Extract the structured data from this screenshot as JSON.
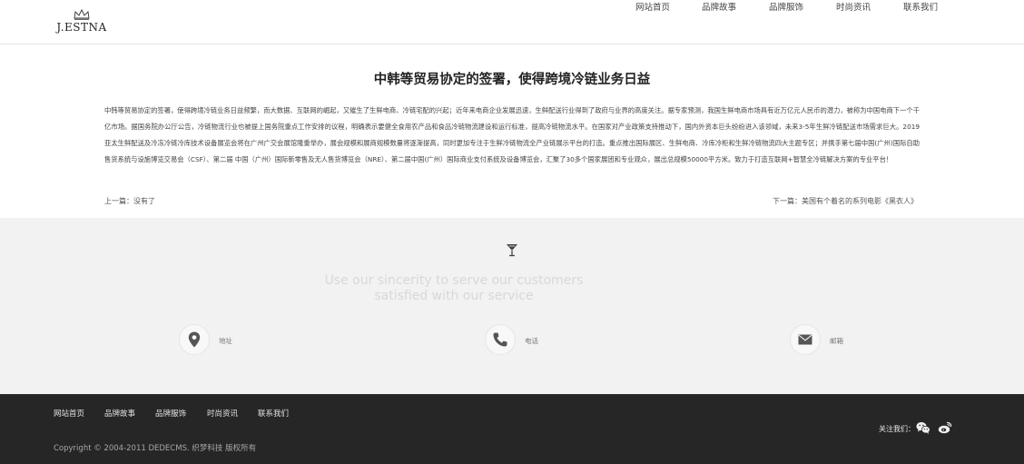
{
  "header": {
    "logo_text": "J.ESTNA",
    "nav": [
      "网站首页",
      "品牌故事",
      "品牌服饰",
      "时尚资讯",
      "联系我们"
    ]
  },
  "article": {
    "title": "中韩等贸易协定的签署，使得跨境冷链业务日益",
    "body": "中韩等贸易协定的签署，使得跨境冷链业务日益频繁，而大数据、互联网的崛起，又催生了生鲜电商、冷链宅配的兴起；近年来电商企业发展迅速，生鲜配送行业得到了政府与业界的高度关注。据专家预测，我国生鲜电商市场具有近万亿元人民币的潜力，被称为中国电商下一个千亿市场。据国务院办公厅公告，冷链物流行业也被提上国务院重点工作安排的议程，明确表示要健全食用农产品和食品冷链物流建设和运行标准，提高冷链物流水平。在国家对产业政策支持推动下，国内外资本巨头纷纷进入该领域，未来3-5年生鲜冷链配送市场需求巨大。2019亚太生鲜配送及冷冻冷链冷库技术设备展览会将在广州广交会展馆隆重举办，展会规模和展商规模数量将逐渐提高，同时更加专注于生鲜冷链物流全产业链展示平台的打造。重点推出国际展区、生鲜电商、冷库冷柜和生鲜冷链物流四大主题专区；并携手第七届中国(广州)国际自助售货系统与设施博览交易会（CSF）、第二届 中国（广州）国际新零售及无人售货博览会（NRE）、第二届中国(广州）国际商业支付系统及设备博览会，汇聚了30多个国家展团和专业观众，展出总规模50000平方米。致力于打造互联网+智慧全冷链解决方案的专业平台！",
    "prev": "上一篇：没有了",
    "next": "下一篇：美国有个着名的系列电影《黑衣人》"
  },
  "slogan": {
    "line1": "Use our sincerity to serve our customers",
    "line2": "satisfied with our service"
  },
  "contacts": [
    {
      "icon": "location-pin-icon",
      "label": "地址"
    },
    {
      "icon": "phone-icon",
      "label": "电话"
    },
    {
      "icon": "envelope-icon",
      "label": "邮箱"
    }
  ],
  "footer": {
    "nav": [
      "网站首页",
      "品牌故事",
      "品牌服饰",
      "时尚资讯",
      "联系我们"
    ],
    "follow_label": "关注我们：",
    "social": [
      "wechat-icon",
      "weibo-icon"
    ],
    "copyright": "Copyright © 2004-2011 DEDECMS. 织梦科技 版权所有"
  },
  "colors": {
    "footer_bg": "#262626",
    "gray_section_bg": "#f2f2f2",
    "icon_gray": "#555555"
  }
}
